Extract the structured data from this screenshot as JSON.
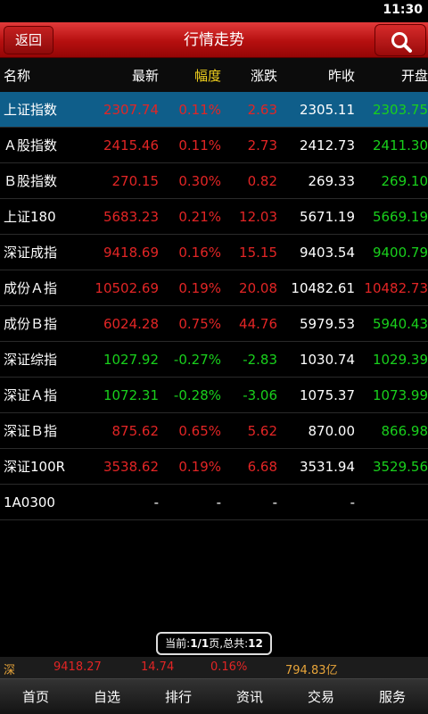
{
  "status_bar": {
    "time": "11:30"
  },
  "title_bar": {
    "back_label": "返回",
    "title": "行情走势"
  },
  "columns": [
    "名称",
    "最新",
    "幅度",
    "涨跌",
    "昨收",
    "开盘"
  ],
  "rows": [
    {
      "name": "上证指数",
      "latest": "2307.74",
      "pct": "0.11%",
      "change": "2.63",
      "prev_close": "2305.11",
      "open": "2303.75",
      "selected": true
    },
    {
      "name": "Ａ股指数",
      "latest": "2415.46",
      "pct": "0.11%",
      "change": "2.73",
      "prev_close": "2412.73",
      "open": "2411.30"
    },
    {
      "name": "Ｂ股指数",
      "latest": "270.15",
      "pct": "0.30%",
      "change": "0.82",
      "prev_close": "269.33",
      "open": "269.10"
    },
    {
      "name": "上证180",
      "latest": "5683.23",
      "pct": "0.21%",
      "change": "12.03",
      "prev_close": "5671.19",
      "open": "5669.19"
    },
    {
      "name": "深证成指",
      "latest": "9418.69",
      "pct": "0.16%",
      "change": "15.15",
      "prev_close": "9403.54",
      "open": "9400.79"
    },
    {
      "name": "成份Ａ指",
      "latest": "10502.69",
      "pct": "0.19%",
      "change": "20.08",
      "prev_close": "10482.61",
      "open": "10482.73"
    },
    {
      "name": "成份Ｂ指",
      "latest": "6024.28",
      "pct": "0.75%",
      "change": "44.76",
      "prev_close": "5979.53",
      "open": "5940.43"
    },
    {
      "name": "深证综指",
      "latest": "1027.92",
      "pct": "-0.27%",
      "change": "-2.83",
      "prev_close": "1030.74",
      "open": "1029.39"
    },
    {
      "name": "深证Ａ指",
      "latest": "1072.31",
      "pct": "-0.28%",
      "change": "-3.06",
      "prev_close": "1075.37",
      "open": "1073.99"
    },
    {
      "name": "深证Ｂ指",
      "latest": "875.62",
      "pct": "0.65%",
      "change": "5.62",
      "prev_close": "870.00",
      "open": "866.98"
    },
    {
      "name": "深证100R",
      "latest": "3538.62",
      "pct": "0.19%",
      "change": "6.68",
      "prev_close": "3531.94",
      "open": "3529.56"
    },
    {
      "name": "1A0300",
      "latest": "-",
      "pct": "-",
      "change": "-",
      "prev_close": "-",
      "open": ""
    }
  ],
  "pager": {
    "prefix": "当前:",
    "page": "1/1",
    "mid": "页,总共:",
    "total": "12"
  },
  "ticker": {
    "market": "深",
    "index": "9418.27",
    "change": "14.74",
    "pct": "0.16%",
    "volume": "794.83亿"
  },
  "bottom_nav": [
    "首页",
    "自选",
    "排行",
    "资讯",
    "交易",
    "服务"
  ],
  "colors": {
    "up": "#e22525",
    "down": "#19d01c",
    "highlight_header": "#f3d21e",
    "selected_row": "#0f5e8a",
    "title_bar": "#b50f0f"
  }
}
